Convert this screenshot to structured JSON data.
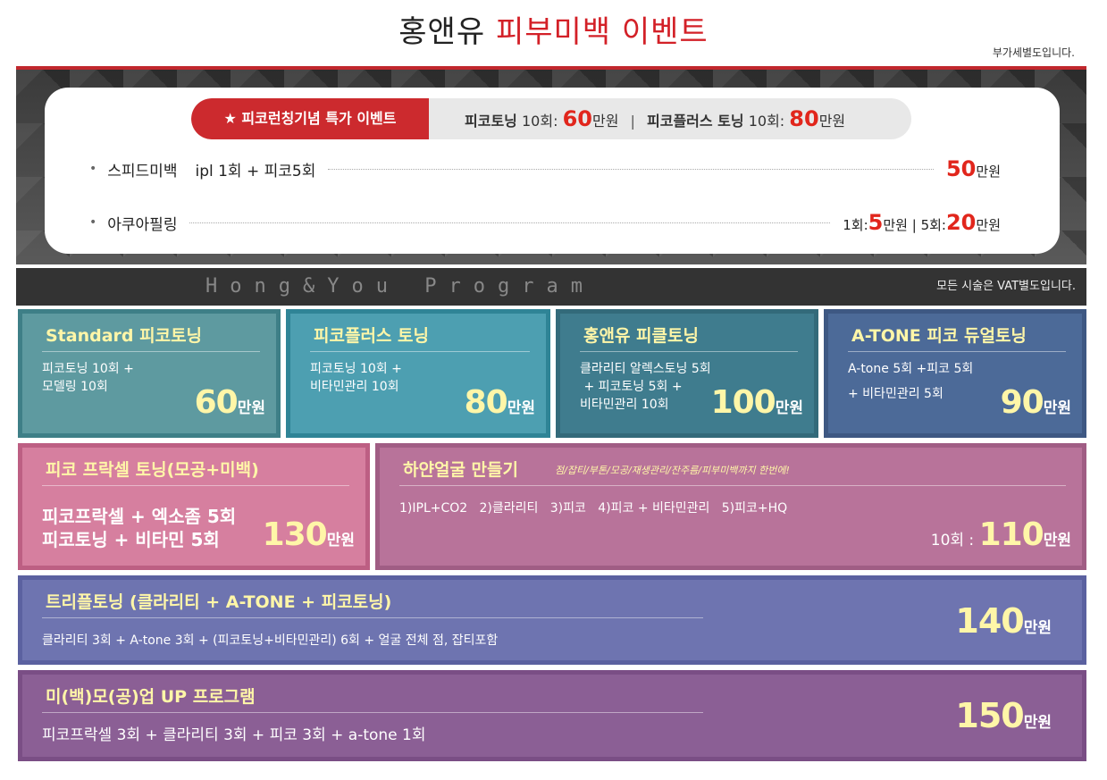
{
  "title": {
    "part1": "홍앤유",
    "part2": "피부미백 이벤트"
  },
  "vat_note": "부가세별도입니다.",
  "promo": {
    "tag": "★ 피코런칭기념 특가 이벤트",
    "item1_name": "피코토닝",
    "item1_count": "10회:",
    "item1_price": "60",
    "item1_unit": "만원",
    "separator": "|",
    "item2_name": "피코플러스 토닝",
    "item2_count": "10회:",
    "item2_price": "80",
    "item2_unit": "만원"
  },
  "hero_rows": [
    {
      "bullet": "•",
      "name": "스피드미백",
      "detail": "ipl 1회 + 피코5회",
      "price": "50",
      "unit": "만원"
    },
    {
      "bullet": "•",
      "name": "아쿠아필링",
      "p1_label": "1회:",
      "p1_price": "5",
      "p1_unit": "만원",
      "sep": "|",
      "p2_label": "5회:",
      "p2_price": "20",
      "p2_unit": "만원"
    }
  ],
  "program": {
    "title": "Hong&You Program",
    "vat": "모든 시술은 VAT별도입니다."
  },
  "boxes": [
    {
      "head": "Standard 피코토닝",
      "lines": [
        "피코토닝 10회 +",
        "모델링 10회"
      ],
      "price": "60",
      "unit": "만원"
    },
    {
      "head": "피코플러스 토닝",
      "lines": [
        "피코토닝 10회 +",
        "비타민관리 10회"
      ],
      "price": "80",
      "unit": "만원"
    },
    {
      "head": "홍앤유 피클토닝",
      "lines": [
        "클라리티 알렉스토닝 5회",
        " + 피코토닝 5회 +",
        "비타민관리 10회"
      ],
      "price": "100",
      "unit": "만원"
    },
    {
      "head": "A-TONE 피코 듀얼토닝",
      "lines": [
        "A-tone 5회 +피코 5회",
        "+ 비타민관리 5회"
      ],
      "price": "90",
      "unit": "만원"
    },
    {
      "head": "피코 프락셀 토닝(모공+미백)",
      "lines": [
        "피코프락셀 + 엑소좀 5회",
        "피코토닝 + 비타민 5회"
      ],
      "price": "130",
      "unit": "만원"
    },
    {
      "head": "하얀얼굴 만들기",
      "sub": "점/잡티/부톤/모공/재생관리/잔주름/피부미백까지 한번에!",
      "lines": [
        "1)IPL+CO2   2)클라리티   3)피코   4)피코 + 비타민관리   5)피코+HQ"
      ],
      "price_pre": "10회 : ",
      "price": "110",
      "unit": "만원"
    },
    {
      "head": "트리플토닝 (클라리티 + A-TONE + 피코토닝)",
      "lines": [
        "클라리티 3회 + A-tone 3회 + (피코토닝+비타민관리) 6회 + 얼굴 전체 점, 잡티포함"
      ],
      "price": "140",
      "unit": "만원"
    },
    {
      "head": "미(백)모(공)업 UP 프로그램",
      "lines": [
        "피코프락셀 3회 + 클라리티 3회 + 피코 3회 + a-tone 1회"
      ],
      "price": "150",
      "unit": "만원"
    }
  ],
  "colors": {
    "accent_red": "#d32027",
    "price_yellow": "#fff6a8"
  }
}
